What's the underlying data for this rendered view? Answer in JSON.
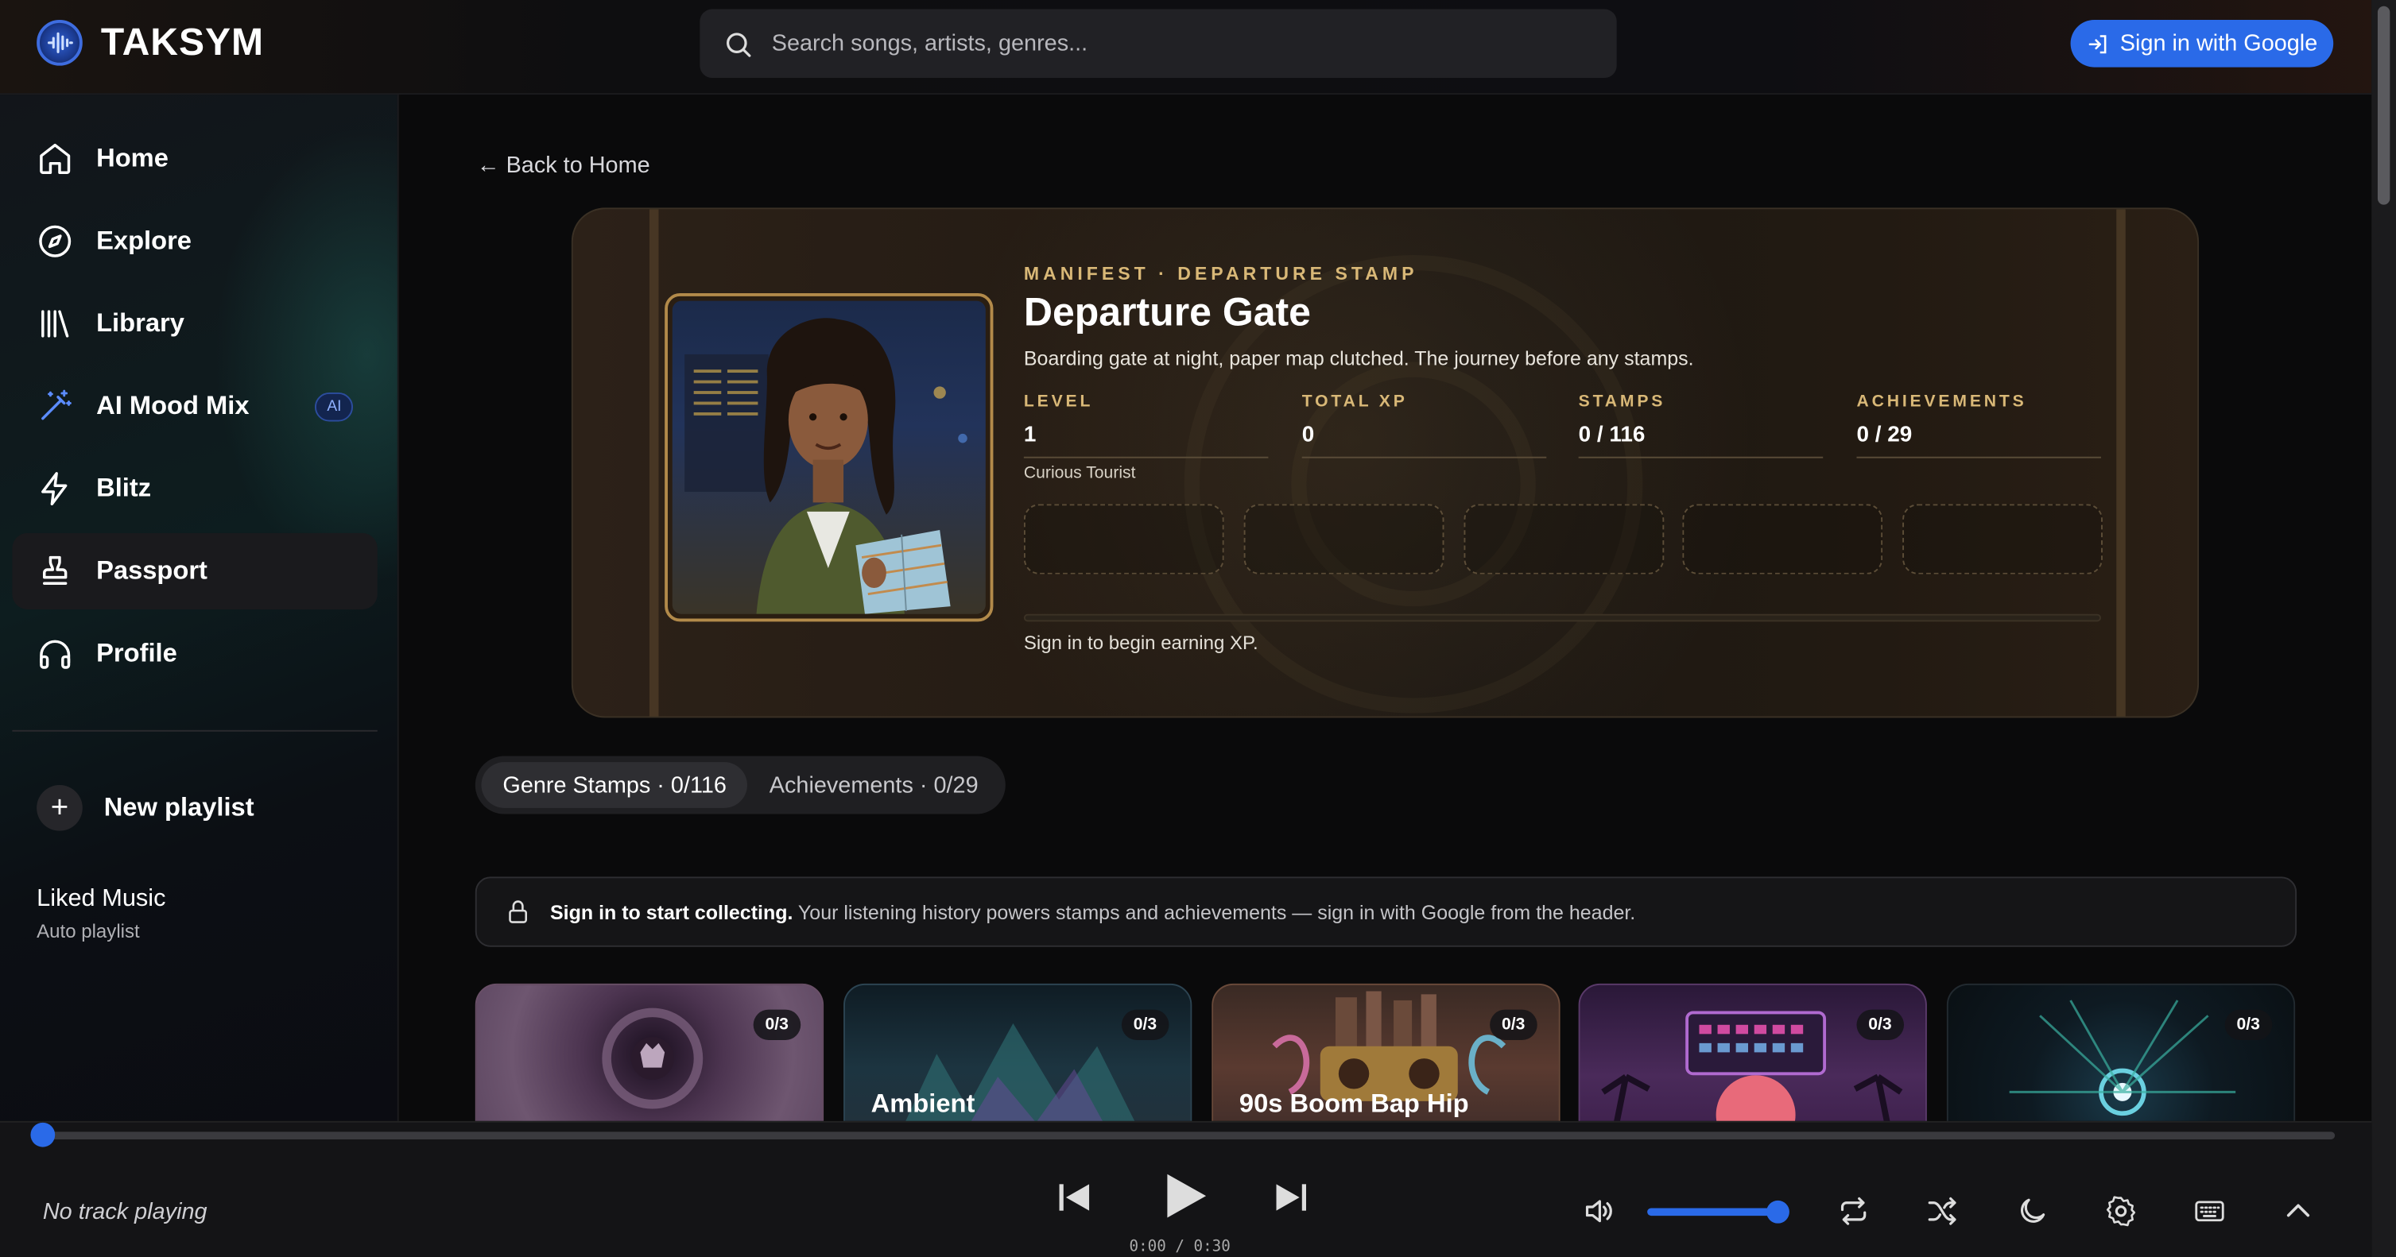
{
  "app": {
    "name": "TAKSYM",
    "colors": {
      "accent": "#2a6ae8",
      "gold": "#d9b877",
      "background": "#0a0a0b"
    }
  },
  "header": {
    "search_placeholder": "Search songs, artists, genres...",
    "signin_label": "Sign in with Google"
  },
  "sidebar": {
    "items": [
      {
        "label": "Home",
        "icon": "home-icon"
      },
      {
        "label": "Explore",
        "icon": "compass-icon"
      },
      {
        "label": "Library",
        "icon": "library-icon"
      },
      {
        "label": "AI Mood Mix",
        "icon": "magic-wand-icon",
        "badge": "AI"
      },
      {
        "label": "Blitz",
        "icon": "lightning-icon"
      },
      {
        "label": "Passport",
        "icon": "stamp-icon",
        "active": true
      },
      {
        "label": "Profile",
        "icon": "headphones-icon"
      }
    ],
    "new_playlist": "New playlist",
    "liked": {
      "title": "Liked Music",
      "subtitle": "Auto playlist"
    }
  },
  "main": {
    "back_label": "← Back to Home",
    "hero": {
      "kicker": "MANIFEST · DEPARTURE STAMP",
      "title": "Departure Gate",
      "description": "Boarding gate at night, paper map clutched. The journey before any stamps.",
      "stats": [
        {
          "key": "LEVEL",
          "value": "1"
        },
        {
          "key": "TOTAL XP",
          "value": "0"
        },
        {
          "key": "STAMPS",
          "value": "0 / 116"
        },
        {
          "key": "ACHIEVEMENTS",
          "value": "0 / 29"
        }
      ],
      "rank": "Curious Tourist",
      "xp_progress": 0,
      "xp_message": "Sign in to begin earning XP."
    },
    "tabs": [
      {
        "label": "Genre Stamps · 0/116",
        "active": true
      },
      {
        "label": "Achievements · 0/29",
        "active": false
      }
    ],
    "notice": {
      "bold": "Sign in to start collecting.",
      "text": " Your listening history powers stamps and achievements — sign in with Google from the header."
    },
    "cards": [
      {
        "name": "",
        "count": "0/3"
      },
      {
        "name": "Ambient",
        "count": "0/3"
      },
      {
        "name": "90s Boom Bap Hip",
        "count": "0/3"
      },
      {
        "name": "",
        "count": "0/3"
      },
      {
        "name": "",
        "count": "0/3"
      }
    ]
  },
  "player": {
    "now_playing": "No track playing",
    "time": "0:00 / 0:30",
    "progress": 0,
    "volume": 0.92
  }
}
